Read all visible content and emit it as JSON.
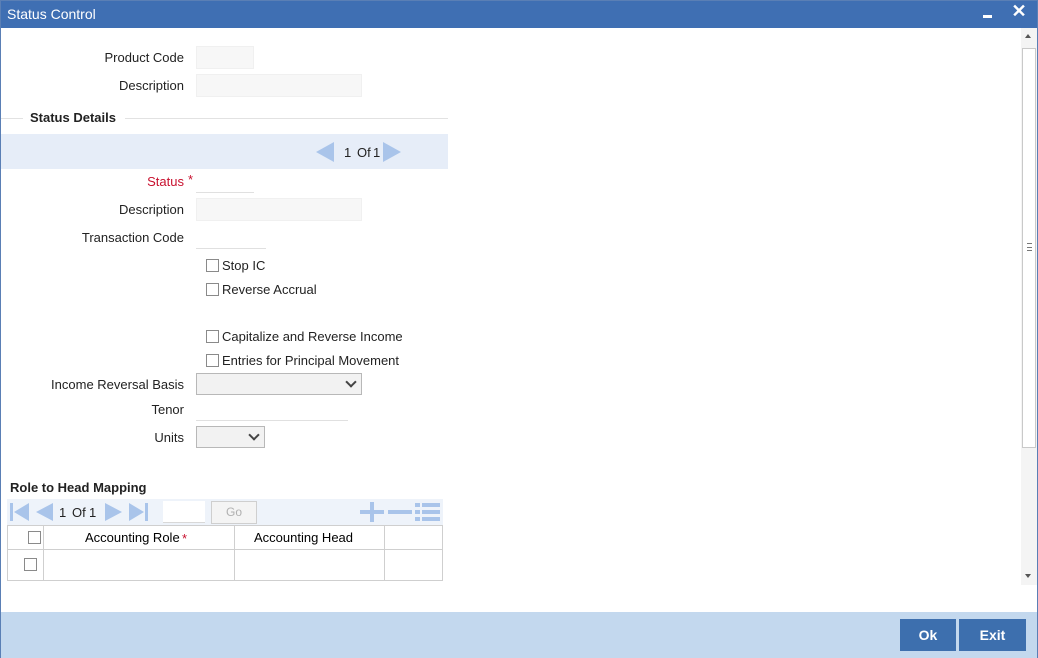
{
  "window": {
    "title": "Status Control",
    "minimize_glyph": "",
    "close_glyph": "✕"
  },
  "form": {
    "product_code_label": "Product Code",
    "description_label": "Description",
    "product_code_value": "",
    "description_value": ""
  },
  "status_details": {
    "section_title": "Status Details",
    "pager": {
      "current": "1",
      "of_label": "Of",
      "total": "1"
    },
    "status_label": "Status",
    "required_mark": "*",
    "description_label": "Description",
    "transaction_code_label": "Transaction Code",
    "checkboxes": {
      "stop_ic": "Stop IC",
      "reverse_accrual": "Reverse Accrual",
      "capitalize_reverse_income": "Capitalize and Reverse Income",
      "entries_principal_movement": "Entries for Principal Movement"
    },
    "income_reversal_basis_label": "Income Reversal Basis",
    "income_reversal_basis_value": "",
    "tenor_label": "Tenor",
    "tenor_value": "",
    "units_label": "Units",
    "units_value": ""
  },
  "role_head_mapping": {
    "section_title": "Role to Head Mapping",
    "pager": {
      "current": "1",
      "of_label": "Of",
      "total": "1"
    },
    "go_label": "Go",
    "columns": [
      "Accounting Role",
      "Accounting Head"
    ],
    "required_mark": "*"
  },
  "footer": {
    "ok_label": "Ok",
    "exit_label": "Exit"
  },
  "colors": {
    "titlebar": "#3f6fb3",
    "required": "#c8102e",
    "footer": "#c3d8ee",
    "button": "#3d6fae"
  }
}
